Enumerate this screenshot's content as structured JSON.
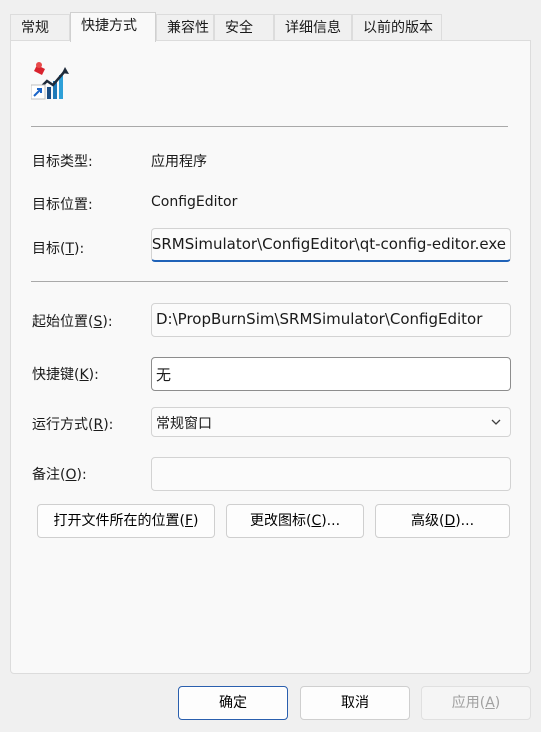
{
  "tabs": [
    {
      "label": "常规",
      "active": false
    },
    {
      "label": "快捷方式",
      "active": true
    },
    {
      "label": "兼容性",
      "active": false
    },
    {
      "label": "安全",
      "active": false
    },
    {
      "label": "详细信息",
      "active": false
    },
    {
      "label": "以前的版本",
      "active": false
    }
  ],
  "shortcut": {
    "icon": "app-chart-rocket-icon",
    "target_type_label": "目标类型:",
    "target_type_value": "应用程序",
    "target_location_label": "目标位置:",
    "target_location_value": "ConfigEditor",
    "target_label": {
      "pre": "目标(",
      "key": "T",
      "post": "):"
    },
    "target_value": "D:\\PropBurnSim\\SRMSimulator\\ConfigEditor\\qt-config-editor.exe",
    "start_in_label": {
      "pre": "起始位置(",
      "key": "S",
      "post": "):"
    },
    "start_in_value": "D:\\PropBurnSim\\SRMSimulator\\ConfigEditor",
    "hotkey_label": {
      "pre": "快捷键(",
      "key": "K",
      "post": "):"
    },
    "hotkey_value": "无",
    "run_label": {
      "pre": "运行方式(",
      "key": "R",
      "post": "):"
    },
    "run_value": "常规窗口",
    "comment_label": {
      "pre": "备注(",
      "key": "O",
      "post": "):"
    },
    "comment_value": "",
    "open_location_button": {
      "pre": "打开文件所在的位置(",
      "key": "F",
      "post": ")"
    },
    "change_icon_button": {
      "pre": "更改图标(",
      "key": "C",
      "post": ")..."
    },
    "advanced_button": {
      "pre": "高级(",
      "key": "D",
      "post": ")..."
    }
  },
  "footer": {
    "ok_label": "确定",
    "cancel_label": "取消",
    "apply_label": {
      "pre": "应用(",
      "key": "A",
      "post": ")"
    }
  }
}
